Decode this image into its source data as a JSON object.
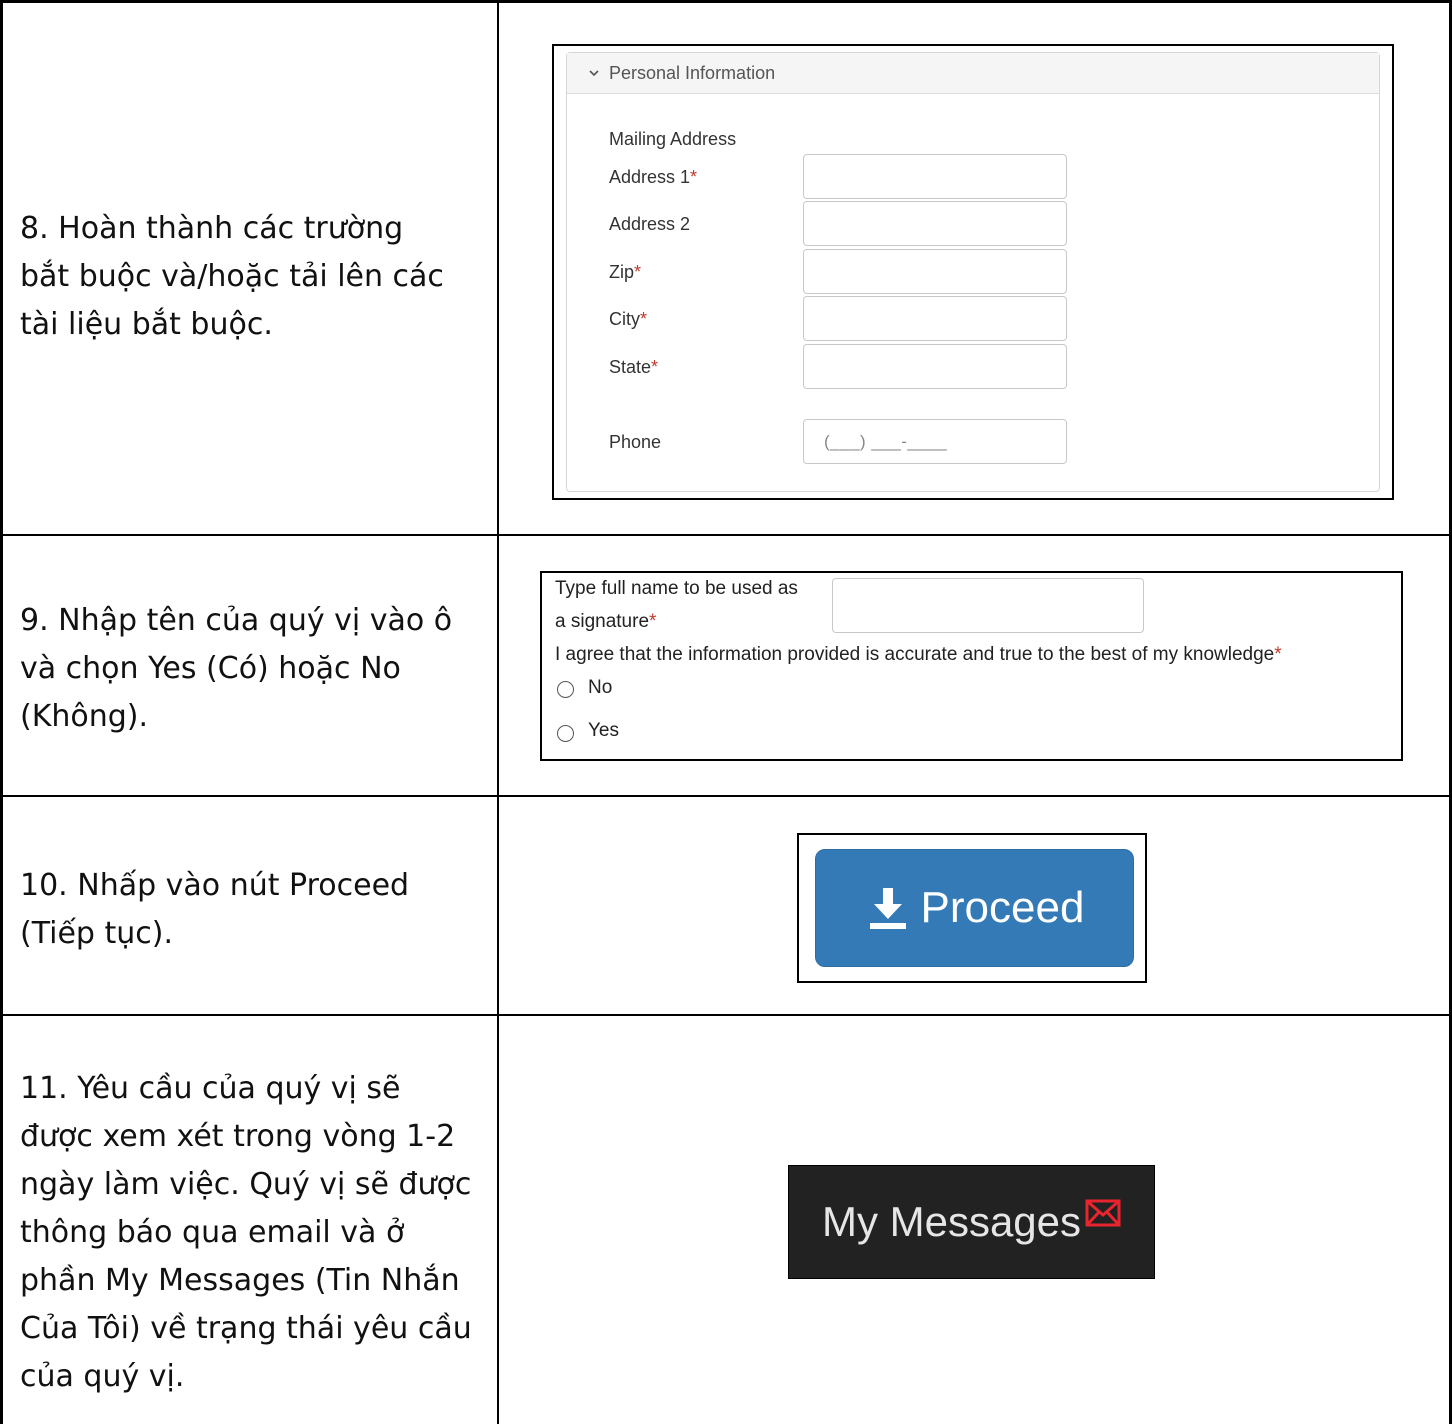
{
  "steps": [
    {
      "line1": "8.   Hoàn thành các trường",
      "line2": "bắt buộc và/hoặc tải lên các",
      "line3": "tài liệu bắt buộc."
    },
    {
      "line1": "9.   Nhập tên của quý vị vào ô",
      "line2": "và chọn Yes (Có) hoặc No",
      "line3": "(Không)."
    },
    {
      "line1": "10.  Nhấp vào nút Proceed",
      "line2": "(Tiếp tục)."
    },
    {
      "line1": "11.  Yêu cầu của quý vị sẽ",
      "line2": "được xem xét trong vòng 1-2",
      "line3": "ngày làm việc. Quý vị sẽ được",
      "line4": "thông báo qua email và ở",
      "line5": "phần My Messages (Tin Nhắn",
      "line6": "Của Tôi) về trạng thái yêu cầu",
      "line7": "của quý vị."
    }
  ],
  "personal_info": {
    "section_title": "Personal Information",
    "mailing_address_label": "Mailing Address",
    "fields": [
      {
        "label": "Address 1",
        "required": "*",
        "value": ""
      },
      {
        "label": "Address 2",
        "required": "",
        "value": ""
      },
      {
        "label": "Zip",
        "required": "*",
        "value": ""
      },
      {
        "label": "City",
        "required": "*",
        "value": ""
      },
      {
        "label": "State",
        "required": "*",
        "value": ""
      }
    ],
    "phone": {
      "label": "Phone",
      "placeholder": "(___) ___-____"
    }
  },
  "signature": {
    "label_line1": "Type full name to be used as",
    "label_line2": "a signature",
    "required": "*",
    "value": "",
    "agreement": "I agree that the information provided is accurate and true to the best of my knowledge",
    "options": [
      "No",
      "Yes"
    ]
  },
  "proceed": {
    "label": "Proceed",
    "icon": "download-icon",
    "color": "#337ab7"
  },
  "messages": {
    "label": "My Messages",
    "icon": "envelope-icon",
    "icon_color": "#e8252e"
  }
}
